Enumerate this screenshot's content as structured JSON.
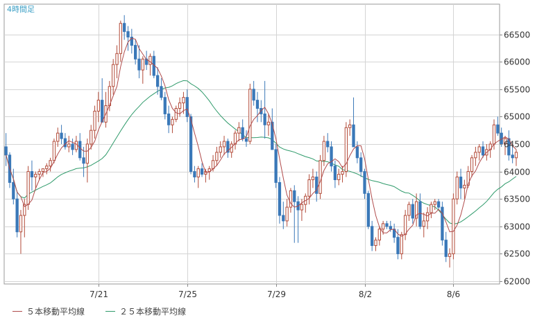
{
  "timeframe_label": "4時間足",
  "legend": {
    "ma5_label": "５本移動平均線",
    "ma25_label": "２５本移動平均線"
  },
  "colors": {
    "up": "#b24a38",
    "down": "#3a78b8",
    "ma5": "#b04a4a",
    "ma25": "#2e9a6a",
    "grid": "#d4d4d4",
    "axis": "#888888",
    "title": "#3a9ec4"
  },
  "chart_data": {
    "type": "candlestick",
    "title": "4時間足",
    "x_ticks": [
      {
        "label": "7/21",
        "index": 25
      },
      {
        "label": "7/25",
        "index": 49
      },
      {
        "label": "7/29",
        "index": 73
      },
      {
        "label": "8/2",
        "index": 97
      },
      {
        "label": "8/6",
        "index": 121
      }
    ],
    "y_ticks": [
      62000,
      62500,
      63000,
      63500,
      64000,
      64500,
      65000,
      65500,
      66000,
      66500
    ],
    "ylim": [
      61950,
      67050
    ],
    "bar_count": 134,
    "candles": [
      [
        64450,
        64700,
        64100,
        64300
      ],
      [
        64300,
        64350,
        63700,
        63800
      ],
      [
        63800,
        64050,
        63400,
        63500
      ],
      [
        63500,
        63650,
        62800,
        62900
      ],
      [
        62900,
        63300,
        62500,
        63200
      ],
      [
        63200,
        63500,
        62800,
        63400
      ],
      [
        63400,
        64100,
        63300,
        64000
      ],
      [
        64000,
        64200,
        63650,
        63900
      ],
      [
        63900,
        64000,
        63700,
        63950
      ],
      [
        63950,
        64050,
        63850,
        64000
      ],
      [
        64000,
        64050,
        63900,
        64050
      ],
      [
        64050,
        64150,
        63950,
        64100
      ],
      [
        64100,
        64250,
        64000,
        64200
      ],
      [
        64200,
        64600,
        64150,
        64550
      ],
      [
        64550,
        64800,
        64450,
        64700
      ],
      [
        64700,
        64850,
        64500,
        64600
      ],
      [
        64600,
        64700,
        64400,
        64450
      ],
      [
        64450,
        64650,
        64350,
        64500
      ],
      [
        64500,
        64600,
        64300,
        64400
      ],
      [
        64400,
        64650,
        64350,
        64550
      ],
      [
        64550,
        64700,
        64200,
        64250
      ],
      [
        64250,
        64450,
        63900,
        64150
      ],
      [
        64150,
        64600,
        63800,
        64500
      ],
      [
        64500,
        64850,
        64400,
        64750
      ],
      [
        64750,
        65200,
        64600,
        65100
      ],
      [
        65100,
        65450,
        64900,
        65300
      ],
      [
        65300,
        65700,
        65000,
        64900
      ],
      [
        64900,
        65450,
        64800,
        65200
      ],
      [
        65200,
        65650,
        65100,
        65550
      ],
      [
        65550,
        66050,
        65400,
        65950
      ],
      [
        65950,
        66300,
        65700,
        66150
      ],
      [
        66150,
        66750,
        66000,
        66700
      ],
      [
        66700,
        66850,
        66400,
        66550
      ],
      [
        66550,
        66650,
        66200,
        66450
      ],
      [
        66450,
        66600,
        66150,
        66300
      ],
      [
        66300,
        66400,
        65950,
        66050
      ],
      [
        66050,
        66300,
        65700,
        65850
      ],
      [
        65850,
        66100,
        65600,
        66050
      ],
      [
        66050,
        66200,
        65850,
        65950
      ],
      [
        65950,
        66150,
        65750,
        66100
      ],
      [
        66100,
        66200,
        65700,
        65750
      ],
      [
        65750,
        65900,
        65400,
        65550
      ],
      [
        65550,
        65700,
        65300,
        65350
      ],
      [
        65350,
        65450,
        64950,
        65050
      ],
      [
        65050,
        65200,
        64700,
        64850
      ],
      [
        64850,
        65000,
        64700,
        64950
      ],
      [
        64950,
        65200,
        64900,
        65150
      ],
      [
        65150,
        65350,
        65000,
        65250
      ],
      [
        65250,
        65450,
        65050,
        65350
      ],
      [
        65350,
        65500,
        64900,
        65000
      ],
      [
        65000,
        65050,
        63950,
        64000
      ],
      [
        64000,
        64100,
        63800,
        63900
      ],
      [
        63900,
        64100,
        63700,
        64050
      ],
      [
        64050,
        64150,
        63900,
        63950
      ],
      [
        63950,
        64050,
        63800,
        64000
      ],
      [
        64000,
        64100,
        63850,
        64050
      ],
      [
        64050,
        64300,
        64000,
        64200
      ],
      [
        64200,
        64450,
        64100,
        64350
      ],
      [
        64350,
        64550,
        64250,
        64450
      ],
      [
        64450,
        64650,
        64300,
        64550
      ],
      [
        64550,
        64600,
        64250,
        64350
      ],
      [
        64350,
        64550,
        64250,
        64500
      ],
      [
        64500,
        64750,
        64400,
        64700
      ],
      [
        64700,
        64900,
        64550,
        64800
      ],
      [
        64800,
        64950,
        64550,
        64600
      ],
      [
        64600,
        64750,
        64450,
        64550
      ],
      [
        64550,
        65600,
        64500,
        65500
      ],
      [
        65500,
        65650,
        65200,
        65300
      ],
      [
        65300,
        65450,
        64900,
        65150
      ],
      [
        65150,
        65300,
        64900,
        65050
      ],
      [
        65050,
        65650,
        64600,
        64850
      ],
      [
        64850,
        65050,
        64650,
        64900
      ],
      [
        64900,
        65150,
        64500,
        64400
      ],
      [
        64400,
        64500,
        63700,
        63800
      ],
      [
        63800,
        63900,
        63050,
        63200
      ],
      [
        63200,
        63450,
        62950,
        63100
      ],
      [
        63100,
        63500,
        63000,
        63350
      ],
      [
        63350,
        63700,
        63250,
        63650
      ],
      [
        63650,
        63750,
        62700,
        63450
      ],
      [
        63450,
        63550,
        62700,
        63300
      ],
      [
        63300,
        63500,
        63100,
        63400
      ],
      [
        63400,
        63600,
        63250,
        63550
      ],
      [
        63550,
        63950,
        63400,
        63850
      ],
      [
        63850,
        64050,
        63700,
        63900
      ],
      [
        63900,
        64000,
        63450,
        63600
      ],
      [
        63600,
        64300,
        63500,
        64200
      ],
      [
        64200,
        64650,
        64100,
        64550
      ],
      [
        64550,
        64700,
        64350,
        64450
      ],
      [
        64450,
        64550,
        64000,
        64100
      ],
      [
        64100,
        64200,
        63700,
        63850
      ],
      [
        63850,
        64050,
        63750,
        63950
      ],
      [
        63950,
        64100,
        63800,
        64000
      ],
      [
        64000,
        64900,
        63900,
        64800
      ],
      [
        64800,
        64950,
        64650,
        64850
      ],
      [
        64850,
        65350,
        64700,
        64450
      ],
      [
        64450,
        64550,
        64150,
        64250
      ],
      [
        64250,
        64350,
        63900,
        64000
      ],
      [
        64000,
        64050,
        63500,
        63600
      ],
      [
        63600,
        63650,
        62950,
        63000
      ],
      [
        63000,
        63100,
        62550,
        62650
      ],
      [
        62650,
        62800,
        62550,
        62750
      ],
      [
        62750,
        63000,
        62650,
        62950
      ],
      [
        62950,
        63100,
        62850,
        63050
      ],
      [
        63050,
        63100,
        62950,
        63000
      ],
      [
        63000,
        63100,
        62900,
        62950
      ],
      [
        62950,
        63050,
        62700,
        62800
      ],
      [
        62800,
        62950,
        62400,
        62500
      ],
      [
        62500,
        62900,
        62400,
        62850
      ],
      [
        62850,
        63300,
        62750,
        63200
      ],
      [
        63200,
        63450,
        63100,
        63400
      ],
      [
        63400,
        63500,
        63050,
        63150
      ],
      [
        63150,
        63600,
        63000,
        63450
      ],
      [
        63450,
        63600,
        62950,
        63000
      ],
      [
        63000,
        63250,
        62800,
        63100
      ],
      [
        63100,
        63350,
        62950,
        63250
      ],
      [
        63250,
        63450,
        63150,
        63400
      ],
      [
        63400,
        63500,
        63300,
        63450
      ],
      [
        63450,
        63500,
        63300,
        63350
      ],
      [
        63350,
        63450,
        62650,
        62750
      ],
      [
        62750,
        62900,
        62350,
        62450
      ],
      [
        62450,
        62600,
        62250,
        62500
      ],
      [
        62500,
        63600,
        62400,
        63500
      ],
      [
        63500,
        64000,
        63400,
        63900
      ],
      [
        63900,
        64050,
        63500,
        63700
      ],
      [
        63700,
        63850,
        63500,
        63750
      ],
      [
        63750,
        64100,
        63700,
        64000
      ],
      [
        64000,
        64300,
        63900,
        64250
      ],
      [
        64250,
        64450,
        64100,
        64350
      ],
      [
        64350,
        64500,
        64200,
        64450
      ],
      [
        64450,
        64550,
        64250,
        64300
      ],
      [
        64300,
        64500,
        64200,
        64400
      ],
      [
        64400,
        64550,
        64250,
        64500
      ],
      [
        64500,
        64950,
        64400,
        64850
      ],
      [
        64850,
        65000,
        64650,
        64700
      ],
      [
        64700,
        64800,
        64450,
        64500
      ],
      [
        64500,
        64650,
        64300,
        64600
      ],
      [
        64600,
        64750,
        64200,
        64300
      ],
      [
        64300,
        64450,
        64150,
        64250
      ],
      [
        64250,
        64400,
        64100,
        64350
      ]
    ]
  }
}
